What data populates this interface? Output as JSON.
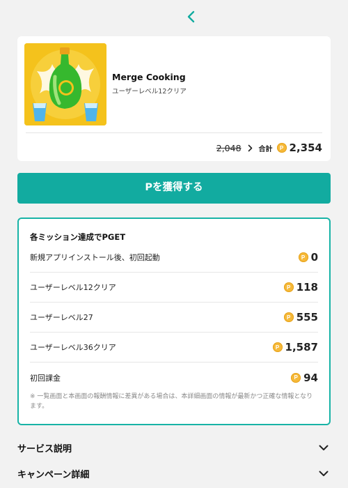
{
  "header": {
    "back_icon": "chevron-left-icon"
  },
  "app": {
    "name": "Merge Cooking",
    "subtitle": "ユーザーレベル12クリア",
    "old_price": "2,048",
    "total_label": "合計",
    "total_value": "2,354",
    "coin_letter": "P"
  },
  "cta": {
    "label": "Pを獲得する"
  },
  "missions": {
    "title": "各ミッション達成でPGET",
    "items": [
      {
        "label": "新規アプリインストール後、初回起動",
        "value": "0"
      },
      {
        "label": "ユーザーレベル12クリア",
        "value": "118"
      },
      {
        "label": "ユーザーレベル27",
        "value": "555"
      },
      {
        "label": "ユーザーレベル36クリア",
        "value": "1,587"
      },
      {
        "label": "初回課金",
        "value": "94"
      }
    ],
    "note": "※ 一覧画面と本画面の報酬情報に差異がある場合は、本詳細画面の情報が最新かつ正確な情報となります。"
  },
  "accordions": [
    {
      "label": "サービス説明"
    },
    {
      "label": "キャンペーン詳細"
    }
  ],
  "colors": {
    "accent": "#12aba0",
    "coin": "#f6b939"
  }
}
